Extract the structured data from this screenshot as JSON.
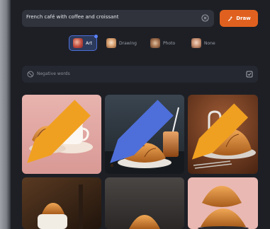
{
  "search": {
    "value": "French café with coffee and croissant",
    "clear_icon": "clear-circle-icon"
  },
  "draw_button": {
    "label": "Draw",
    "icon": "sparkle-brush-icon",
    "color": "#e0611f"
  },
  "styles": [
    {
      "label": "Art",
      "active": true
    },
    {
      "label": "Drawing",
      "active": false
    },
    {
      "label": "Photo",
      "active": false
    },
    {
      "label": "None",
      "active": false
    }
  ],
  "negative": {
    "label": "Negative words",
    "icon": "no-entry-icon",
    "toggle_icon": "checkbox-icon"
  },
  "gallery": {
    "edit_icon": "pencil-icon",
    "images": [
      "croissant-with-coffee-cup-pink",
      "croissant-with-iced-coffee-dark",
      "croissant-with-faucet-brown",
      "croissant-in-cup-dark",
      "croissant-on-gray",
      "croissant-stack-pink"
    ]
  },
  "colors": {
    "accent": "#e0611f",
    "active_chip": "#4e6fd9"
  }
}
